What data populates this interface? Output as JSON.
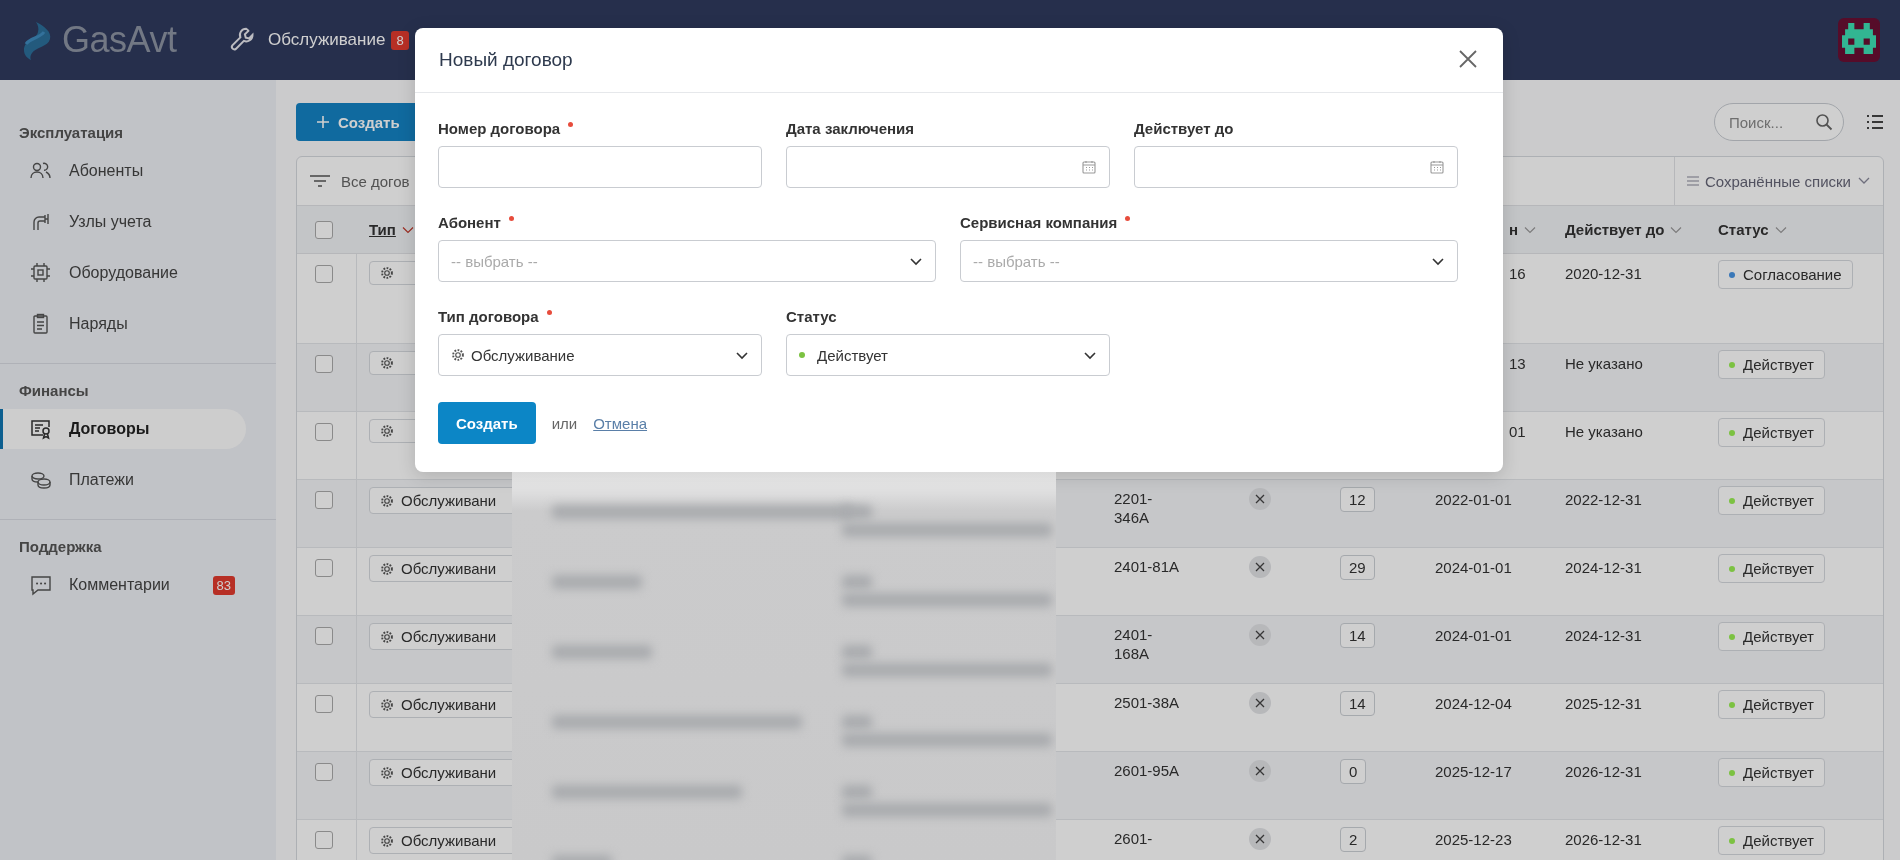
{
  "header": {
    "logo": "**Gas**Avt",
    "nav": [
      {
        "label": "Обслуживание",
        "badge": "8"
      }
    ]
  },
  "sidebar": {
    "sections": [
      {
        "title": "Эксплуатация",
        "items": [
          {
            "label": "Абоненты",
            "selected": false
          },
          {
            "label": "Узлы учета",
            "selected": false
          },
          {
            "label": "Оборудование",
            "selected": false
          },
          {
            "label": "Наряды",
            "selected": false
          }
        ]
      },
      {
        "title": "Финансы",
        "items": [
          {
            "label": "Договоры",
            "selected": true
          },
          {
            "label": "Платежи",
            "selected": false
          }
        ]
      },
      {
        "title": "Поддержка",
        "items": [
          {
            "label": "Комментарии",
            "selected": false,
            "badge": "83"
          }
        ]
      }
    ]
  },
  "toolbar": {
    "create_button": "Создать",
    "search": {
      "placeholder": "Поиск..."
    }
  },
  "table": {
    "filter_label": "Все догов",
    "saved_lists": "Сохранённые списки",
    "select_all": {
      "checked": false
    },
    "columns": {
      "type": {
        "label": "Тип",
        "sorted": true
      },
      "column_8": {
        "label": "н",
        "sorted": false
      },
      "due": {
        "label": "Действует до",
        "sorted": false
      },
      "status": {
        "label": "Статус",
        "sorted": false
      }
    },
    "rows": [
      {
        "checked": false,
        "column_8": "16",
        "due": "2020-12-31",
        "status": {
          "label": "Согласование",
          "color": "#3a78b8"
        }
      },
      {
        "checked": false,
        "column_8": "13",
        "due": "Не указано",
        "status": {
          "label": "Действует",
          "color": "#7cc242"
        }
      },
      {
        "checked": false,
        "column_8": "01",
        "due": "Не указано",
        "status": {
          "label": "Действует",
          "color": "#7cc242"
        }
      },
      {
        "checked": false,
        "type": "Обслуживани",
        "column_5": "2201-346A",
        "column_7": "12",
        "column_8": "2022-01-01",
        "due": "2022-12-31",
        "status": {
          "label": "Действует",
          "color": "#7cc242"
        }
      },
      {
        "checked": false,
        "type": "Обслуживани",
        "column_5": "2401-81A",
        "column_7": "29",
        "column_8": "2024-01-01",
        "due": "2024-12-31",
        "status": {
          "label": "Действует",
          "color": "#7cc242"
        }
      },
      {
        "checked": false,
        "type": "Обслуживани",
        "column_5": "2401-168A",
        "column_7": "14",
        "column_8": "2024-01-01",
        "due": "2024-12-31",
        "status": {
          "label": "Действует",
          "color": "#7cc242"
        }
      },
      {
        "checked": false,
        "type": "Обслуживани",
        "column_5": "2501-38A",
        "column_7": "14",
        "column_8": "2024-12-04",
        "due": "2025-12-31",
        "status": {
          "label": "Действует",
          "color": "#7cc242"
        }
      },
      {
        "checked": false,
        "type": "Обслуживани",
        "column_5": "2601-95A",
        "column_7": "0",
        "column_8": "2025-12-17",
        "due": "2026-12-31",
        "status": {
          "label": "Действует",
          "color": "#7cc242"
        }
      },
      {
        "checked": false,
        "type": "Обслуживани",
        "column_5": "2601-",
        "column_7": "2",
        "column_8": "2025-12-23",
        "due": "2026-12-31",
        "status": {
          "label": "Действует",
          "color": "#7cc242"
        }
      }
    ]
  },
  "modal": {
    "title": "Новый договор",
    "fields": [
      {
        "label": "Номер договора",
        "required": true,
        "kind": "text"
      },
      {
        "label": "Дата заключения",
        "required": false,
        "kind": "date"
      },
      {
        "label": "Действует до",
        "required": false,
        "kind": "date"
      },
      {
        "label": "Абонент",
        "required": true,
        "kind": "select",
        "placeholder": "-- выбрать --"
      },
      {
        "label": "Сервисная компания",
        "required": true,
        "kind": "select",
        "placeholder": "-- выбрать --"
      },
      {
        "label": "Тип договора",
        "required": true,
        "kind": "type-select",
        "value": "Обслуживание"
      },
      {
        "label": "Статус",
        "required": false,
        "kind": "status-select",
        "value": "Действует",
        "color": "#7cc242"
      }
    ],
    "submit": "Создать",
    "or": "или",
    "cancel": "Отмена"
  }
}
